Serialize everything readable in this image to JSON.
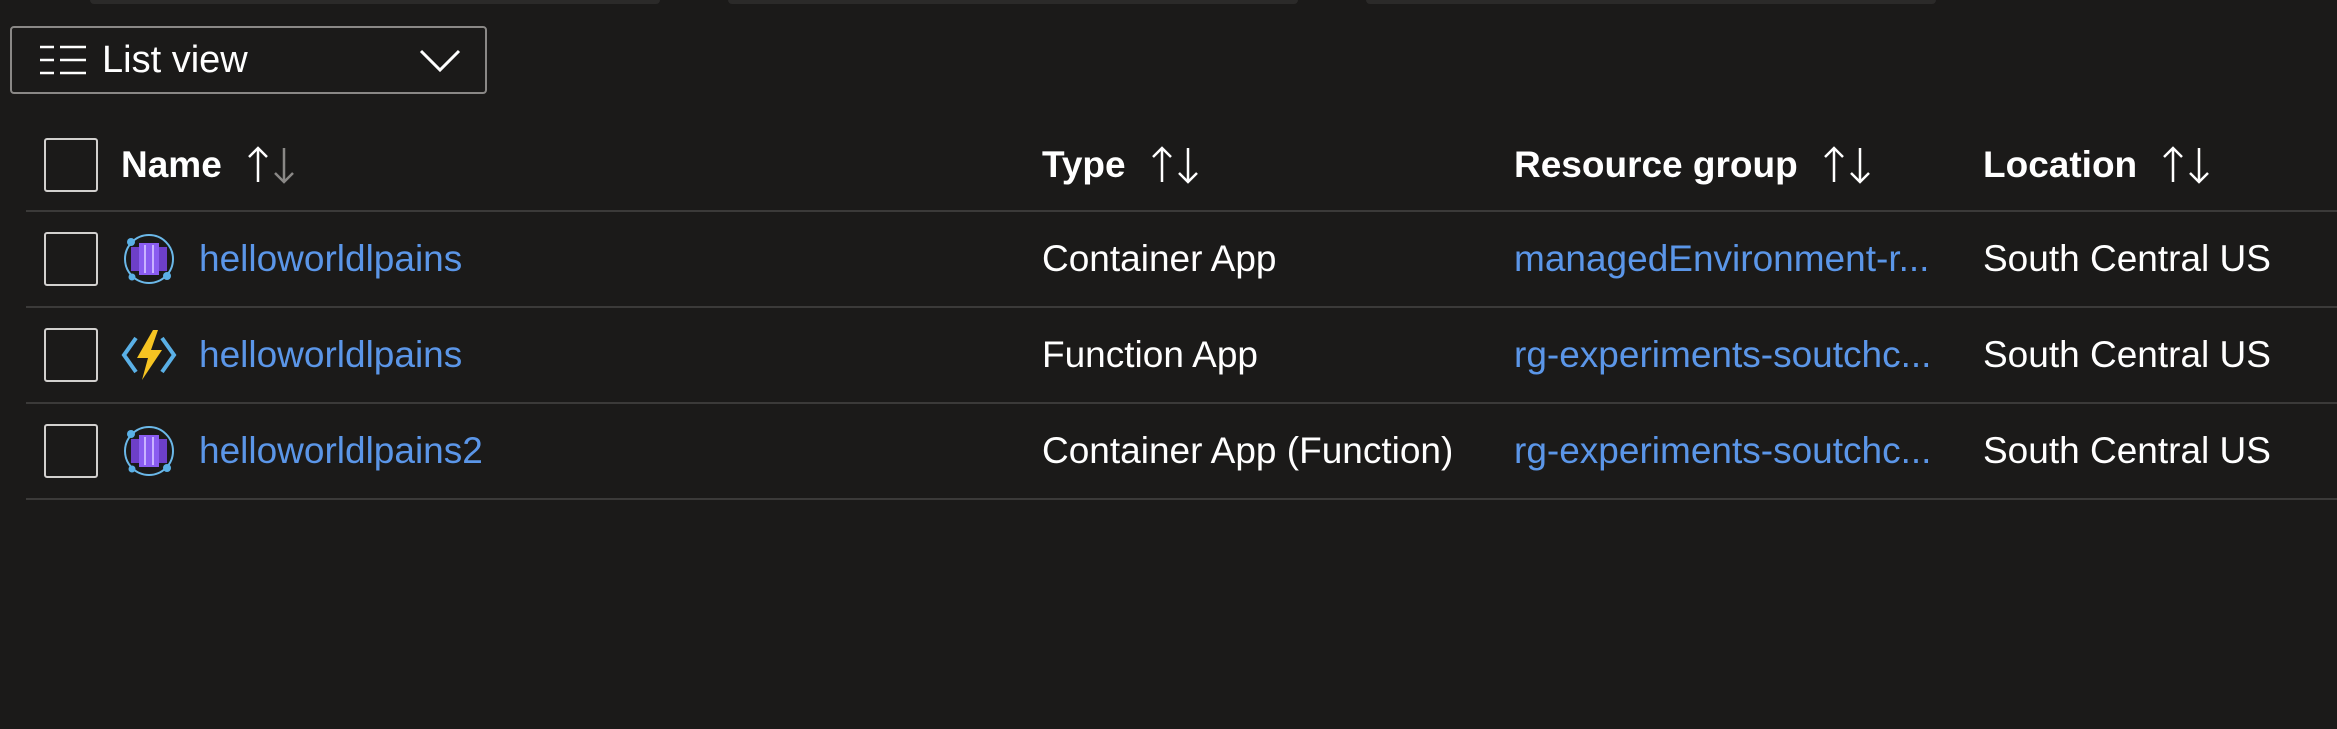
{
  "view_selector": {
    "label": "List view",
    "icon": "list-view-icon"
  },
  "columns": [
    {
      "key": "name",
      "label": "Name"
    },
    {
      "key": "type",
      "label": "Type"
    },
    {
      "key": "resource_group",
      "label": "Resource group"
    },
    {
      "key": "location",
      "label": "Location"
    }
  ],
  "rows": [
    {
      "name": "helloworldlpains",
      "type": "Container App",
      "resource_group": "managedEnvironment-r...",
      "location": "South Central US",
      "icon": "container-app-icon"
    },
    {
      "name": "helloworldlpains",
      "type": "Function App",
      "resource_group": "rg-experiments-soutchc...",
      "location": "South Central US",
      "icon": "function-app-icon"
    },
    {
      "name": "helloworldlpains2",
      "type": "Container App (Function)",
      "resource_group": "rg-experiments-soutchc...",
      "location": "South Central US",
      "icon": "container-app-icon"
    }
  ],
  "colors": {
    "background": "#1b1a19",
    "link": "#5b96e8",
    "divider": "#3b3a39",
    "accent_purple": "#7b4fd6",
    "accent_bolt": "#f6c422"
  }
}
